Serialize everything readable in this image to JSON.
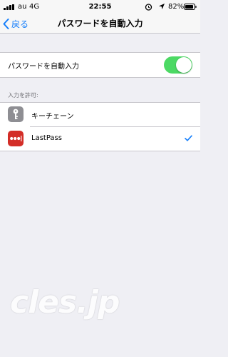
{
  "status_bar": {
    "carrier": "au",
    "network": "4G",
    "time": "22:55",
    "battery": "82%",
    "icons": [
      "signal-icon",
      "alarm-icon",
      "location-icon",
      "battery-icon"
    ]
  },
  "nav": {
    "back_label": "戻る",
    "title": "パスワードを自動入力"
  },
  "autofill": {
    "label": "パスワードを自動入力",
    "enabled": true
  },
  "allow_section": {
    "header": "入力を許可:",
    "items": [
      {
        "label": "キーチェーン",
        "icon": "key-icon",
        "selected": false
      },
      {
        "label": "LastPass",
        "icon": "lastpass-icon",
        "selected": true
      }
    ]
  },
  "watermark": "cles.jp",
  "colors": {
    "accent": "#147efb",
    "toggle_on": "#4cd964",
    "lastpass": "#d32d27",
    "keychain": "#8e8e93",
    "background": "#efeff4"
  }
}
